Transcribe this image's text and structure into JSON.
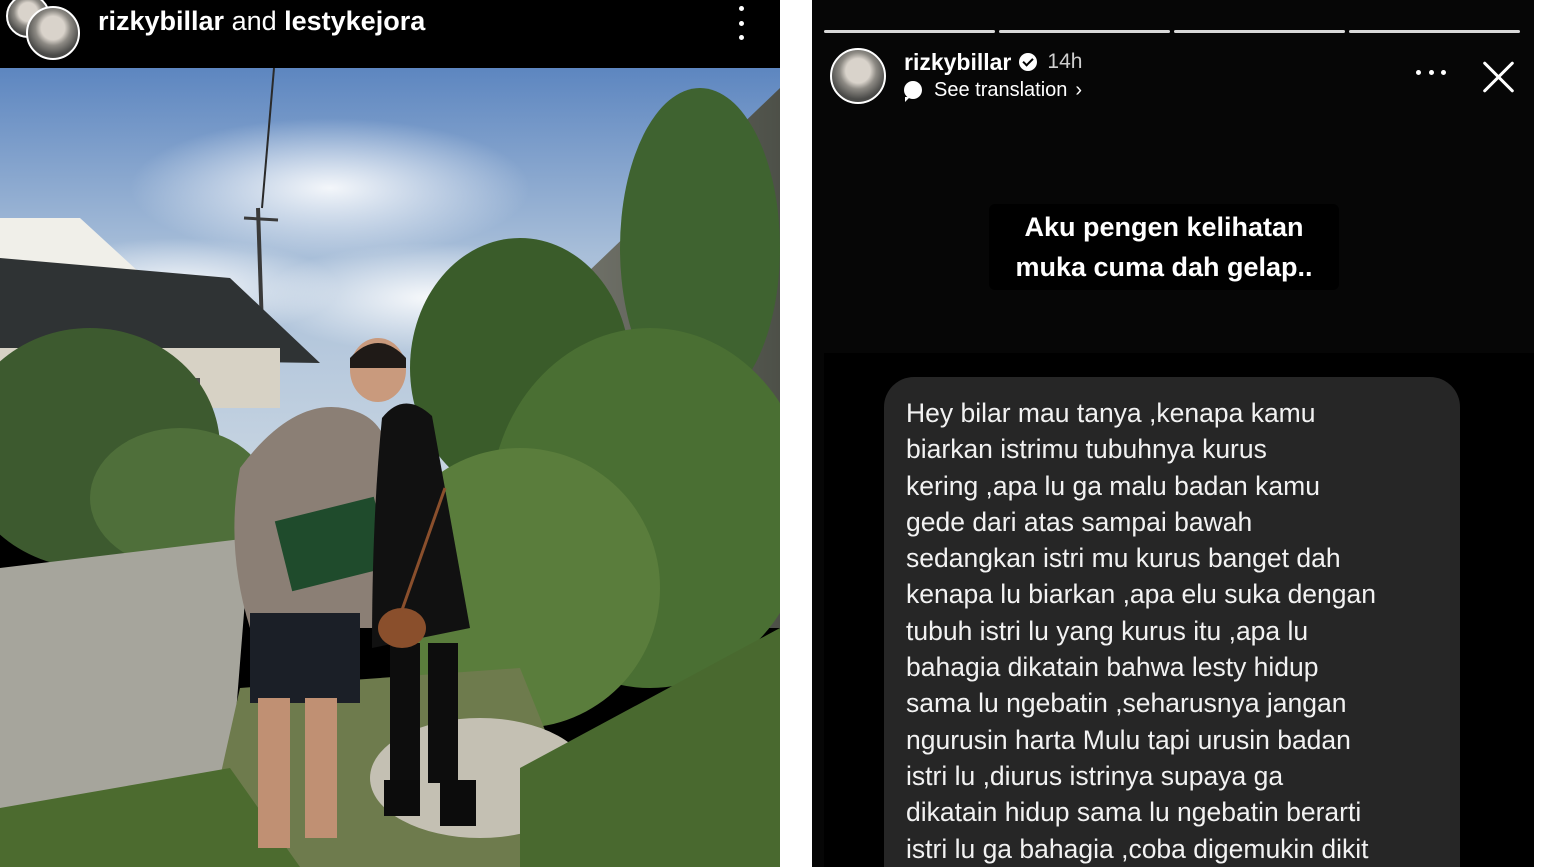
{
  "left_post": {
    "user1": "rizkybillar",
    "connector": " and ",
    "user2": "lestykejora",
    "more_icon": "more-vertical-icon"
  },
  "story": {
    "username": "rizkybillar",
    "time": "14h",
    "translation_label": "See translation",
    "caption": "Aku pengen kelihatan muka cuma dah gelap..",
    "message": "Hey bilar mau tanya ,kenapa kamu\nbiarkan istrimu tubuhnya kurus\nkering ,apa lu ga malu badan kamu\ngede dari atas sampai bawah\nsedangkan istri mu kurus banget dah\nkenapa lu biarkan ,apa elu suka dengan\ntubuh istri lu yang kurus itu ,apa lu\nbahagia dikatain bahwa lesty hidup\nsama lu ngebatin ,seharusnya jangan\nngurusin harta Mulu tapi urusin badan\nistri lu ,diurus istrinya supaya ga\ndikatain hidup sama lu ngebatin berarti\nistri lu ga bahagia ,coba digemukin dikit",
    "icons": [
      "verified-badge-icon",
      "translate-icon",
      "chevron-right-icon",
      "more-horizontal-icon",
      "close-icon"
    ]
  },
  "colors": {
    "background": "#000000",
    "bubble": "#262626",
    "text": "#ffffff"
  }
}
